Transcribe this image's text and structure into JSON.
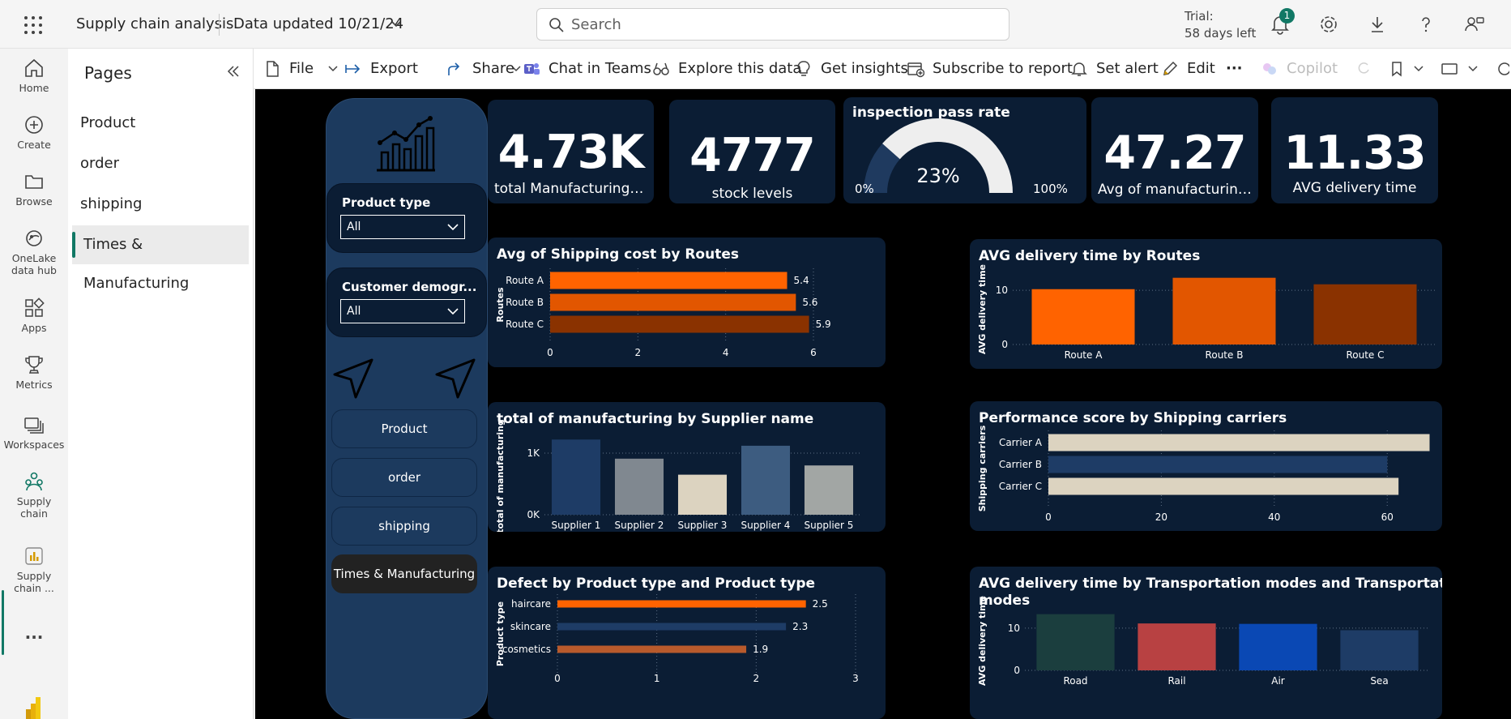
{
  "topbar": {
    "app_title": "Supply chain analysis",
    "data_updated": "Data updated 10/21/24",
    "search_placeholder": "Search",
    "trial_line1": "Trial:",
    "trial_line2": "58 days left",
    "notification_count": "1"
  },
  "leftnav": {
    "items": [
      {
        "label": "Home",
        "icon": "home-icon"
      },
      {
        "label": "Create",
        "icon": "plus-circle-icon"
      },
      {
        "label": "Browse",
        "icon": "folder-icon"
      },
      {
        "label": "OneLake",
        "label2": "data hub",
        "icon": "onelake-icon"
      },
      {
        "label": "Apps",
        "icon": "apps-icon"
      },
      {
        "label": "Metrics",
        "icon": "trophy-icon"
      },
      {
        "label": "Workspaces",
        "icon": "workspaces-icon"
      },
      {
        "label": "Supply",
        "label2": "chain",
        "icon": "workspace-people-icon"
      },
      {
        "label": "Supply",
        "label2": "chain ...",
        "icon": "report-icon"
      }
    ],
    "more": "..."
  },
  "pages": {
    "title": "Pages",
    "items": [
      "Product",
      "order",
      "shipping",
      "Times & Manufacturing"
    ],
    "active": "Times & Manufacturing"
  },
  "actions": {
    "file": "File",
    "export": "Export",
    "share": "Share",
    "chat": "Chat in Teams",
    "explore": "Explore this data",
    "insights": "Get insights",
    "subscribe": "Subscribe to report",
    "alert": "Set alert",
    "edit": "Edit",
    "more": "···",
    "copilot": "Copilot"
  },
  "report": {
    "slicers": [
      {
        "title": "Product type",
        "value": "All"
      },
      {
        "title": "Customer demogr...",
        "value": "All"
      }
    ],
    "nav_buttons": [
      "Product",
      "order",
      "shipping",
      "Times & Manufacturing"
    ],
    "nav_active": "Times & Manufacturing",
    "kpis": [
      {
        "value": "4.73K",
        "label": "total Manufacturing cost"
      },
      {
        "value": "4777",
        "label": "stock levels"
      },
      {
        "value": "47.27",
        "label": "Avg of manufacturing ..."
      },
      {
        "value": "11.33",
        "label": "AVG delivery time"
      }
    ],
    "gauge": {
      "title": "inspection pass rate",
      "value_label": "23%",
      "min_label": "0%",
      "max_label": "100%",
      "value": 23,
      "min": 0,
      "max": 100,
      "fill_color": "#1f3a5f",
      "track_color": "#eeeeee"
    }
  },
  "chart_data": [
    {
      "id": "shipcost",
      "type": "bar",
      "orientation": "horizontal",
      "title": "Avg of Shipping cost by Routes",
      "ylabel": "Routes",
      "categories": [
        "Route A",
        "Route B",
        "Route C"
      ],
      "values": [
        5.4,
        5.6,
        5.9
      ],
      "data_labels": [
        "5.4",
        "5.6",
        "5.9"
      ],
      "xlim": [
        0,
        6
      ],
      "xticks": [
        "0",
        "2",
        "4",
        "6"
      ],
      "colors": [
        "#ff6300",
        "#e25600",
        "#8a3200"
      ]
    },
    {
      "id": "deliveryroute",
      "type": "bar",
      "title": "AVG delivery time by Routes",
      "ylabel": "AVG delivery time",
      "categories": [
        "Route A",
        "Route B",
        "Route C"
      ],
      "values": [
        10.2,
        12.3,
        11.1
      ],
      "ylim": [
        0,
        13
      ],
      "yticks": [
        {
          "value": 0,
          "label": "0"
        },
        {
          "value": 10,
          "label": "10"
        }
      ],
      "colors": [
        "#ff6300",
        "#e25600",
        "#8a3200"
      ]
    },
    {
      "id": "supplier",
      "type": "bar",
      "title": "total of manufacturing by Supplier name",
      "ylabel": "total of manufacturing",
      "categories": [
        "Supplier 1",
        "Supplier 2",
        "Supplier 3",
        "Supplier 4",
        "Supplier 5"
      ],
      "values": [
        1220,
        910,
        650,
        1120,
        800
      ],
      "ylim": [
        0,
        1250
      ],
      "yticks": [
        {
          "value": 0,
          "label": "0K"
        },
        {
          "value": 1000,
          "label": "1K"
        }
      ],
      "colors": [
        "#1e3c66",
        "#808890",
        "#dcd3c0",
        "#3d5c80",
        "#a2a6a4"
      ]
    },
    {
      "id": "carriers",
      "type": "bar",
      "orientation": "horizontal",
      "title": "Performance score by Shipping carriers",
      "ylabel": "Shipping carriers",
      "categories": [
        "Carrier A",
        "Carrier B",
        "Carrier C"
      ],
      "values": [
        67.5,
        60,
        62
      ],
      "xlim": [
        0,
        68
      ],
      "xticks": [
        {
          "value": 0,
          "label": "0"
        },
        {
          "value": 20,
          "label": "20"
        },
        {
          "value": 40,
          "label": "40"
        },
        {
          "value": 60,
          "label": "60"
        }
      ],
      "colors": [
        "#dcd3c0",
        "#1e3c66",
        "#dcd3c0"
      ]
    },
    {
      "id": "defect",
      "type": "bar",
      "orientation": "horizontal",
      "title": "Defect by Product type and Product type",
      "ylabel": "Product type",
      "categories": [
        "haircare",
        "skincare",
        "cosmetics"
      ],
      "values": [
        2.5,
        2.3,
        1.9
      ],
      "data_labels": [
        "2.5",
        "2.3",
        "1.9"
      ],
      "xlim": [
        0,
        3
      ],
      "xticks": [
        "0",
        "1",
        "2",
        "3"
      ],
      "colors": [
        "#ff6300",
        "#1e3c66",
        "#b85a2c"
      ]
    },
    {
      "id": "transport",
      "type": "bar",
      "title": "AVG delivery time by Transportation modes and Transportation modes",
      "title_line1": "AVG delivery time by Transportation modes and Transportation",
      "title_line2": "modes",
      "ylabel": "AVG delivery time",
      "categories": [
        "Road",
        "Rail",
        "Air",
        "Sea"
      ],
      "values": [
        13.3,
        11.1,
        11.0,
        9.5
      ],
      "ylim": [
        0,
        14
      ],
      "yticks": [
        {
          "value": 0,
          "label": "0"
        },
        {
          "value": 10,
          "label": "10"
        }
      ],
      "colors": [
        "#1b3e3e",
        "#b84142",
        "#0a48b4",
        "#1e3c66"
      ]
    }
  ]
}
